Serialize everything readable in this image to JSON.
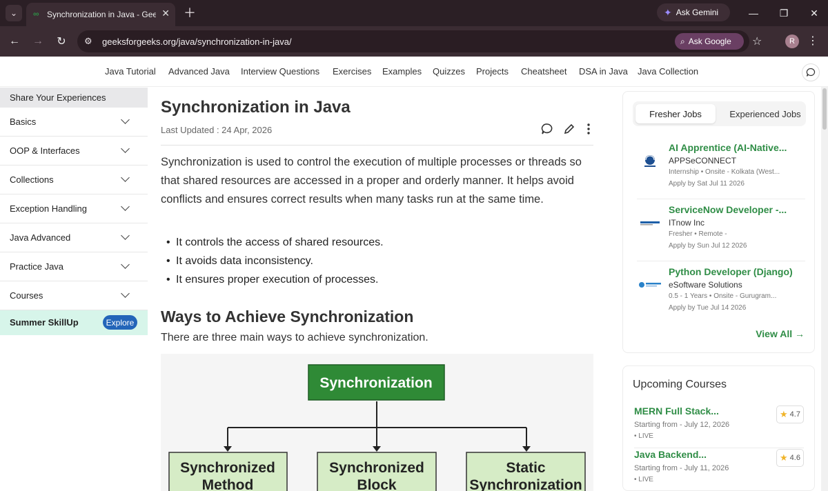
{
  "browser": {
    "tab_title": "Synchronization in Java - GeeksforGeeks",
    "ask_gemini": "Ask Gemini",
    "url": "geeksforgeeks.org/java/synchronization-in-java/",
    "ask_google": "Ask Google",
    "profile_initial": "R"
  },
  "site_nav": {
    "items": [
      "Java Tutorial",
      "Advanced Java",
      "Interview Questions",
      "Exercises",
      "Examples",
      "Quizzes",
      "Projects",
      "Cheatsheet",
      "DSA in Java",
      "Java Collection"
    ]
  },
  "sidebar": {
    "share": "Share Your Experiences",
    "items": [
      "Basics",
      "OOP & Interfaces",
      "Collections",
      "Exception Handling",
      "Java Advanced",
      "Practice Java",
      "Courses"
    ],
    "summer_label": "Summer SkillUp",
    "explore_label": "Explore"
  },
  "article": {
    "title": "Synchronization in Java",
    "updated": "Last Updated : 24 Apr, 2026",
    "paragraph": "Synchronization is used to control the execution of multiple processes or threads so that shared resources are accessed in a proper and orderly manner. It helps avoid conflicts and ensures correct results when many tasks run at the same time.",
    "bullets": [
      "It controls the access of shared resources.",
      "It avoids data inconsistency.",
      "It ensures proper execution of processes."
    ],
    "heading2": "Ways to Achieve Synchronization",
    "ways_text": "There are three main ways to achieve synchronization.",
    "diagram": {
      "root": "Synchronization",
      "children": [
        {
          "line1": "Synchronized",
          "line2": "Method"
        },
        {
          "line1": "Synchronized",
          "line2": "Block"
        },
        {
          "line1": "Static",
          "line2": "Synchronization"
        }
      ]
    }
  },
  "jobs": {
    "tabs": [
      "Fresher Jobs",
      "Experienced Jobs"
    ],
    "items": [
      {
        "title": "AI Apprentice (AI-Native...",
        "company": "APPSeCONNECT",
        "meta": "Internship • Onsite - Kolkata (West...",
        "apply": "Apply by Sat Jul 11 2026"
      },
      {
        "title": "ServiceNow Developer -...",
        "company": "ITnow Inc",
        "meta": "Fresher • Remote -",
        "apply": "Apply by Sun Jul 12 2026"
      },
      {
        "title": "Python Developer (Django)",
        "company": "eSoftware Solutions",
        "meta": "0.5 - 1 Years • Onsite - Gurugram...",
        "apply": "Apply by Tue Jul 14 2026"
      }
    ],
    "view_all": "View All →"
  },
  "courses": {
    "title": "Upcoming Courses",
    "items": [
      {
        "name": "MERN Full Stack...",
        "start": "Starting from - July 12, 2026",
        "live": "• LIVE",
        "rating": "4.7"
      },
      {
        "name": "Java Backend...",
        "start": "Starting from - July 11, 2026",
        "live": "• LIVE",
        "rating": "4.6"
      }
    ]
  },
  "colors": {
    "brand_green": "#2f8d46",
    "chrome_dark": "#3b2c33",
    "explore_blue": "#2365b9"
  }
}
